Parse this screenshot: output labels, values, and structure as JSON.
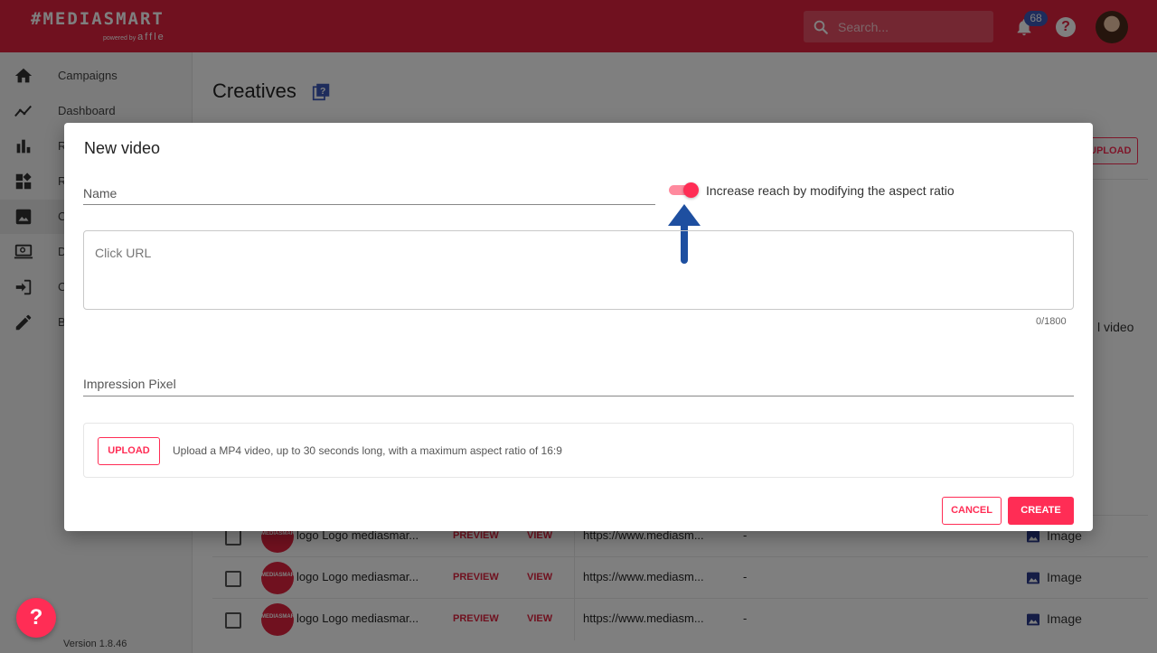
{
  "header": {
    "brand": "#MEDIASMART",
    "powered_by": "powered by",
    "affle": "affle",
    "search_placeholder": "Search...",
    "notifications_count": "68"
  },
  "sidebar": {
    "items": [
      {
        "label": "Campaigns",
        "icon": "home-icon"
      },
      {
        "label": "Dashboard",
        "icon": "trending-icon"
      },
      {
        "label": "R",
        "icon": "bar-chart-icon"
      },
      {
        "label": "R",
        "icon": "widgets-icon"
      },
      {
        "label": "C",
        "icon": "image-icon"
      },
      {
        "label": "D",
        "icon": "laptop-search-icon"
      },
      {
        "label": "C",
        "icon": "login-icon"
      },
      {
        "label": "B",
        "icon": "pencil-icon"
      }
    ],
    "version": "Version 1.8.46"
  },
  "main": {
    "title": "Creatives",
    "upload_label": "UPLOAD",
    "bg_video_text": "l video",
    "rows": [
      {
        "name": "logo Logo mediasmar...",
        "preview": "PREVIEW",
        "view": "VIEW",
        "url": "https://www.mediasm...",
        "dash": "-",
        "type": "Image"
      },
      {
        "name": "logo Logo mediasmar...",
        "preview": "PREVIEW",
        "view": "VIEW",
        "url": "https://www.mediasm...",
        "dash": "-",
        "type": "Image"
      },
      {
        "name": "logo Logo mediasmar...",
        "preview": "PREVIEW",
        "view": "VIEW",
        "url": "https://www.mediasm...",
        "dash": "-",
        "type": "Image"
      }
    ],
    "thumb_text": "MEDIASMART"
  },
  "modal": {
    "title": "New video",
    "name_label": "Name",
    "toggle_label": "Increase reach by modifying the aspect ratio",
    "toggle_on": true,
    "click_url_label": "Click URL",
    "counter": "0/1800",
    "impression_label": "Impression Pixel",
    "upload_button": "UPLOAD",
    "upload_hint": "Upload a MP4 video, up to 30 seconds long, with a maximum aspect ratio of 16:9",
    "cancel_button": "CANCEL",
    "create_button": "CREATE"
  },
  "colors": {
    "brand": "#e0233f",
    "accent": "#ff2d55",
    "arrow": "#1e4fa0",
    "badge": "#3c58b8"
  },
  "fab_label": "?"
}
